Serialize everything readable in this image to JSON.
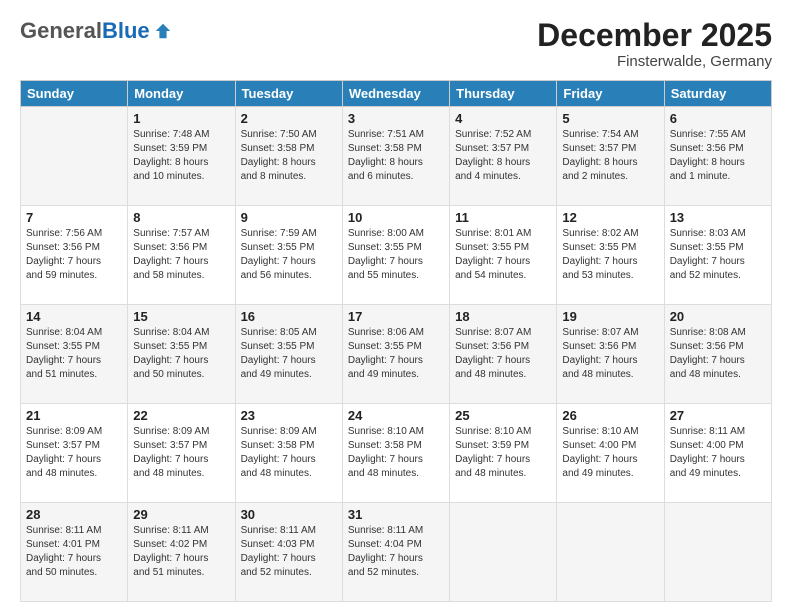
{
  "logo": {
    "general": "General",
    "blue": "Blue"
  },
  "header": {
    "month": "December 2025",
    "location": "Finsterwalde, Germany"
  },
  "weekdays": [
    "Sunday",
    "Monday",
    "Tuesday",
    "Wednesday",
    "Thursday",
    "Friday",
    "Saturday"
  ],
  "weeks": [
    [
      {
        "day": "",
        "content": ""
      },
      {
        "day": "1",
        "content": "Sunrise: 7:48 AM\nSunset: 3:59 PM\nDaylight: 8 hours\nand 10 minutes."
      },
      {
        "day": "2",
        "content": "Sunrise: 7:50 AM\nSunset: 3:58 PM\nDaylight: 8 hours\nand 8 minutes."
      },
      {
        "day": "3",
        "content": "Sunrise: 7:51 AM\nSunset: 3:58 PM\nDaylight: 8 hours\nand 6 minutes."
      },
      {
        "day": "4",
        "content": "Sunrise: 7:52 AM\nSunset: 3:57 PM\nDaylight: 8 hours\nand 4 minutes."
      },
      {
        "day": "5",
        "content": "Sunrise: 7:54 AM\nSunset: 3:57 PM\nDaylight: 8 hours\nand 2 minutes."
      },
      {
        "day": "6",
        "content": "Sunrise: 7:55 AM\nSunset: 3:56 PM\nDaylight: 8 hours\nand 1 minute."
      }
    ],
    [
      {
        "day": "7",
        "content": "Sunrise: 7:56 AM\nSunset: 3:56 PM\nDaylight: 7 hours\nand 59 minutes."
      },
      {
        "day": "8",
        "content": "Sunrise: 7:57 AM\nSunset: 3:56 PM\nDaylight: 7 hours\nand 58 minutes."
      },
      {
        "day": "9",
        "content": "Sunrise: 7:59 AM\nSunset: 3:55 PM\nDaylight: 7 hours\nand 56 minutes."
      },
      {
        "day": "10",
        "content": "Sunrise: 8:00 AM\nSunset: 3:55 PM\nDaylight: 7 hours\nand 55 minutes."
      },
      {
        "day": "11",
        "content": "Sunrise: 8:01 AM\nSunset: 3:55 PM\nDaylight: 7 hours\nand 54 minutes."
      },
      {
        "day": "12",
        "content": "Sunrise: 8:02 AM\nSunset: 3:55 PM\nDaylight: 7 hours\nand 53 minutes."
      },
      {
        "day": "13",
        "content": "Sunrise: 8:03 AM\nSunset: 3:55 PM\nDaylight: 7 hours\nand 52 minutes."
      }
    ],
    [
      {
        "day": "14",
        "content": "Sunrise: 8:04 AM\nSunset: 3:55 PM\nDaylight: 7 hours\nand 51 minutes."
      },
      {
        "day": "15",
        "content": "Sunrise: 8:04 AM\nSunset: 3:55 PM\nDaylight: 7 hours\nand 50 minutes."
      },
      {
        "day": "16",
        "content": "Sunrise: 8:05 AM\nSunset: 3:55 PM\nDaylight: 7 hours\nand 49 minutes."
      },
      {
        "day": "17",
        "content": "Sunrise: 8:06 AM\nSunset: 3:55 PM\nDaylight: 7 hours\nand 49 minutes."
      },
      {
        "day": "18",
        "content": "Sunrise: 8:07 AM\nSunset: 3:56 PM\nDaylight: 7 hours\nand 48 minutes."
      },
      {
        "day": "19",
        "content": "Sunrise: 8:07 AM\nSunset: 3:56 PM\nDaylight: 7 hours\nand 48 minutes."
      },
      {
        "day": "20",
        "content": "Sunrise: 8:08 AM\nSunset: 3:56 PM\nDaylight: 7 hours\nand 48 minutes."
      }
    ],
    [
      {
        "day": "21",
        "content": "Sunrise: 8:09 AM\nSunset: 3:57 PM\nDaylight: 7 hours\nand 48 minutes."
      },
      {
        "day": "22",
        "content": "Sunrise: 8:09 AM\nSunset: 3:57 PM\nDaylight: 7 hours\nand 48 minutes."
      },
      {
        "day": "23",
        "content": "Sunrise: 8:09 AM\nSunset: 3:58 PM\nDaylight: 7 hours\nand 48 minutes."
      },
      {
        "day": "24",
        "content": "Sunrise: 8:10 AM\nSunset: 3:58 PM\nDaylight: 7 hours\nand 48 minutes."
      },
      {
        "day": "25",
        "content": "Sunrise: 8:10 AM\nSunset: 3:59 PM\nDaylight: 7 hours\nand 48 minutes."
      },
      {
        "day": "26",
        "content": "Sunrise: 8:10 AM\nSunset: 4:00 PM\nDaylight: 7 hours\nand 49 minutes."
      },
      {
        "day": "27",
        "content": "Sunrise: 8:11 AM\nSunset: 4:00 PM\nDaylight: 7 hours\nand 49 minutes."
      }
    ],
    [
      {
        "day": "28",
        "content": "Sunrise: 8:11 AM\nSunset: 4:01 PM\nDaylight: 7 hours\nand 50 minutes."
      },
      {
        "day": "29",
        "content": "Sunrise: 8:11 AM\nSunset: 4:02 PM\nDaylight: 7 hours\nand 51 minutes."
      },
      {
        "day": "30",
        "content": "Sunrise: 8:11 AM\nSunset: 4:03 PM\nDaylight: 7 hours\nand 52 minutes."
      },
      {
        "day": "31",
        "content": "Sunrise: 8:11 AM\nSunset: 4:04 PM\nDaylight: 7 hours\nand 52 minutes."
      },
      {
        "day": "",
        "content": ""
      },
      {
        "day": "",
        "content": ""
      },
      {
        "day": "",
        "content": ""
      }
    ]
  ]
}
